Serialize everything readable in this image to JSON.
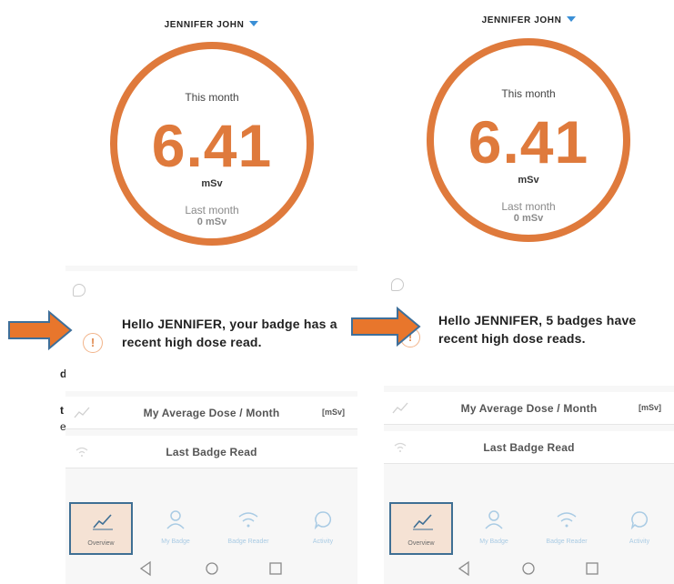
{
  "fragments": [
    "d",
    "t",
    "e"
  ],
  "screens": [
    {
      "user_name": "JENNIFER JOHN",
      "dose_card": {
        "this_month_label": "This month",
        "dose_value": "6.41",
        "dose_unit": "mSv",
        "last_month_label": "Last month",
        "last_month_value": "0 mSv"
      },
      "alert": {
        "message": "Hello JENNIFER, your badge has a recent high dose read."
      },
      "rows": {
        "average_dose_label": "My Average Dose / Month",
        "average_dose_unit": "[mSv]",
        "last_badge_read_label": "Last Badge Read"
      },
      "tabs": [
        {
          "label": "Overview",
          "icon": "line-chart-icon",
          "active": true
        },
        {
          "label": "My Badge",
          "icon": "person-icon",
          "active": false
        },
        {
          "label": "Badge Reader",
          "icon": "wifi-icon",
          "active": false
        },
        {
          "label": "Activity",
          "icon": "chat-bubble-icon",
          "active": false
        }
      ]
    },
    {
      "user_name": "JENNIFER JOHN",
      "dose_card": {
        "this_month_label": "This month",
        "dose_value": "6.41",
        "dose_unit": "mSv",
        "last_month_label": "Last month",
        "last_month_value": "0 mSv"
      },
      "alert": {
        "message": "Hello JENNIFER, 5 badges have recent high dose reads."
      },
      "rows": {
        "average_dose_label": "My Average Dose / Month",
        "average_dose_unit": "[mSv]",
        "last_badge_read_label": "Last Badge Read"
      },
      "tabs": [
        {
          "label": "Overview",
          "icon": "line-chart-icon",
          "active": true
        },
        {
          "label": "My Badge",
          "icon": "person-icon",
          "active": false
        },
        {
          "label": "Badge Reader",
          "icon": "wifi-icon",
          "active": false
        },
        {
          "label": "Activity",
          "icon": "chat-bubble-icon",
          "active": false
        }
      ]
    }
  ],
  "colors": {
    "accent": "#df7a3c",
    "arrow": "#e8762c",
    "arrow_border": "#3e6f9a",
    "highlight_border": "#3f6f94",
    "tab_inactive": "#a9cbe4",
    "caret": "#3a8fd6"
  }
}
